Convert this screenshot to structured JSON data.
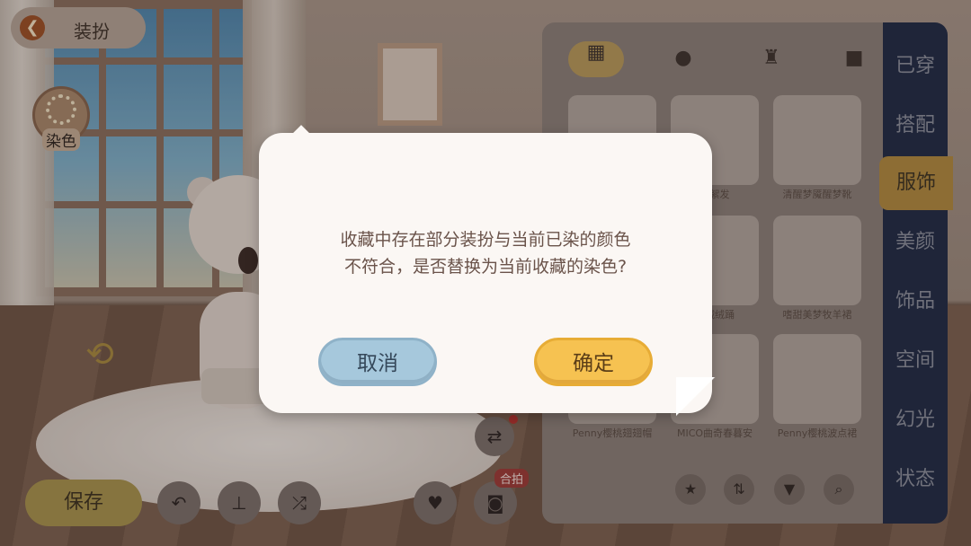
{
  "header": {
    "back_icon": "back-arrow-icon",
    "title": "装扮"
  },
  "dye": {
    "label": "染色",
    "icon": "dye-wheel-icon"
  },
  "bottom_bar": {
    "save_label": "保存",
    "tools": [
      "undo-icon",
      "unwear-icon",
      "shuffle-icon",
      "heart-icon",
      "camera-icon"
    ],
    "photo_badge": "合拍",
    "outfit_icon": "outfit-swap-icon"
  },
  "categories": [
    "grid-icon",
    "hair-icon",
    "dress-icon",
    "shirt-icon"
  ],
  "items": [
    {
      "label": "",
      "tag": "dye-available-icon"
    },
    {
      "label": "梦絮发",
      "tag": "dye-available-icon"
    },
    {
      "label": "清醒梦魇醒梦靴",
      "tag": "dye-available-icon"
    },
    {
      "label": "",
      "tag": ""
    },
    {
      "label": "梦绒绒踊",
      "tag": ""
    },
    {
      "label": "嗜甜美梦牧羊裙",
      "tag": "dye-available-icon"
    },
    {
      "label": "Penny樱桃翅翅帽",
      "tag": ""
    },
    {
      "label": "MICO曲奇春暮安",
      "tag": ""
    },
    {
      "label": "Penny樱桃波点裙",
      "tag": "dye-available-icon"
    }
  ],
  "list_tools": [
    "star-icon",
    "sort-icon",
    "filter-icon",
    "search-icon"
  ],
  "side_tabs": [
    {
      "label": "已穿",
      "active": false
    },
    {
      "label": "搭配",
      "active": false
    },
    {
      "label": "服饰",
      "active": true
    },
    {
      "label": "美颜",
      "active": false
    },
    {
      "label": "饰品",
      "active": false
    },
    {
      "label": "空间",
      "active": false
    },
    {
      "label": "幻光",
      "active": false
    },
    {
      "label": "状态",
      "active": false
    }
  ],
  "dialog": {
    "message_line1": "收藏中存在部分装扮与当前已染的颜色",
    "message_line2": "不符合，是否替换为当前收藏的染色?",
    "cancel_label": "取消",
    "confirm_label": "确定"
  },
  "colors": {
    "cancel": "#a6c8dc",
    "confirm": "#f6c251",
    "active_tab": "#b28a3e",
    "tab_strip": "#1f2a45"
  }
}
